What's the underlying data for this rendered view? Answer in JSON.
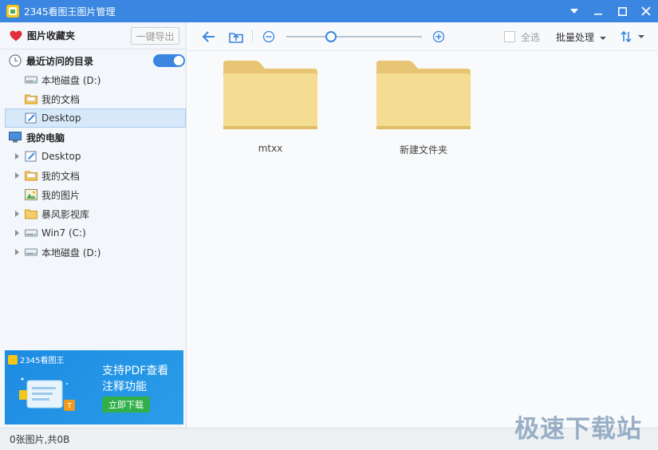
{
  "titlebar": {
    "title": "2345看图王图片管理",
    "controls": [
      "dropdown",
      "minimize",
      "maximize",
      "close"
    ]
  },
  "sidebar": {
    "favorites_label": "图片收藏夹",
    "export_label": "一键导出",
    "recent": {
      "label": "最近访问的目录",
      "toggle_on": true,
      "items": [
        {
          "label": "本地磁盘 (D:)",
          "icon": "drive-icon"
        },
        {
          "label": "我的文档",
          "icon": "documents-folder-icon"
        },
        {
          "label": "Desktop",
          "icon": "desktop-icon",
          "selected": true
        }
      ]
    },
    "computer": {
      "label": "我的电脑",
      "items": [
        {
          "label": "Desktop",
          "icon": "desktop-icon",
          "expandable": true
        },
        {
          "label": "我的文档",
          "icon": "documents-folder-icon",
          "expandable": true
        },
        {
          "label": "我的图片",
          "icon": "pictures-icon",
          "expandable": false
        },
        {
          "label": "暴风影视库",
          "icon": "folder-icon",
          "expandable": true
        },
        {
          "label": "Win7 (C:)",
          "icon": "drive-icon",
          "expandable": true
        },
        {
          "label": "本地磁盘 (D:)",
          "icon": "drive-icon",
          "expandable": true
        }
      ]
    }
  },
  "ad": {
    "brand": "2345看图王",
    "title_line1": "支持PDF查看",
    "title_line2": "注释功能",
    "button": "立即下载"
  },
  "toolbar": {
    "zoom_level": 0.33,
    "select_all": "全选",
    "batch": "批量处理"
  },
  "folders": [
    {
      "name": "mtxx"
    },
    {
      "name": "新建文件夹"
    }
  ],
  "status": {
    "text": "0张图片,共0B"
  },
  "watermark": "极速下载站",
  "colors": {
    "accent": "#3a86e0",
    "folder": "#f2d78a",
    "ad_button": "#31b04a"
  }
}
